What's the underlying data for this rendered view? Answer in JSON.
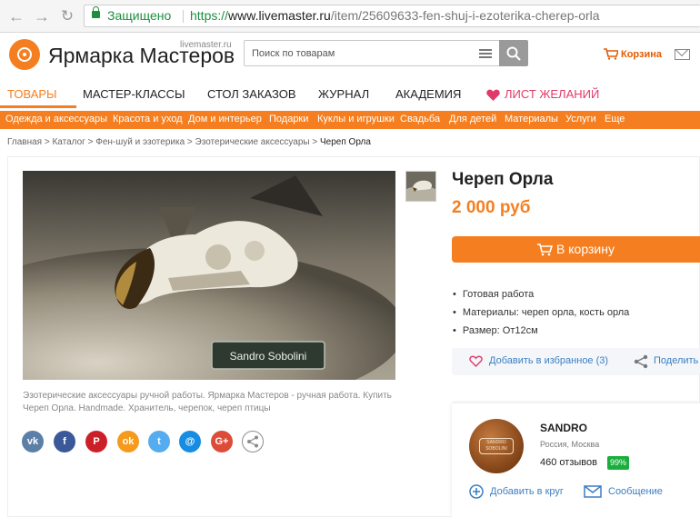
{
  "browser": {
    "secure_label": "Защищено",
    "url_scheme": "https://",
    "url_host": "www.livemaster.ru",
    "url_path": "/item/25609633-fen-shuj-i-ezoterika-cherep-orla"
  },
  "header": {
    "brand": "Ярмарка Мастеров",
    "brand_sub": "livemaster.ru",
    "search_placeholder": "Поиск по товарам",
    "cart_label": "Корзина"
  },
  "main_nav": [
    {
      "label": "ТОВАРЫ"
    },
    {
      "label": "МАСТЕР-КЛАССЫ"
    },
    {
      "label": "СТОЛ ЗАКАЗОВ"
    },
    {
      "label": "ЖУРНАЛ"
    },
    {
      "label": "АКАДЕМИЯ"
    },
    {
      "label": "ЛИСТ ЖЕЛАНИЙ"
    }
  ],
  "categories": [
    {
      "label": "Одежда и аксессуары"
    },
    {
      "label": "Красота и уход"
    },
    {
      "label": "Дом и интерьер"
    },
    {
      "label": "Подарки"
    },
    {
      "label": "Куклы и игрушки"
    },
    {
      "label": "Свадьба"
    },
    {
      "label": "Для детей"
    },
    {
      "label": "Материалы"
    },
    {
      "label": "Услуги"
    },
    {
      "label": "Еще"
    }
  ],
  "breadcrumbs": [
    {
      "label": "Главная"
    },
    {
      "label": "Каталог"
    },
    {
      "label": "Фен-шуй и эзотерика"
    },
    {
      "label": "Эзотерические аксессуары"
    },
    {
      "label": "Череп Орла"
    }
  ],
  "product": {
    "watermark": "Sandro Sobolini",
    "caption": "Эзотерические аксессуары ручной работы. Ярмарка Мастеров - ручная работа. Купить Череп Орла. Handmade. Хранитель, черепок, череп птицы",
    "title": "Череп Орла",
    "price": "2 000 руб",
    "buy_label": "В корзину",
    "properties": [
      {
        "text": "Готовая работа"
      },
      {
        "text": "Материалы:  череп орла, кость орла"
      },
      {
        "text": "Размер: От12см"
      }
    ],
    "favorite_label": "Добавить в избранное (3)",
    "share_label": "Поделить"
  },
  "social": [
    {
      "label": "vk",
      "icon": "vk-icon",
      "color": "#5b7fa6"
    },
    {
      "label": "f",
      "icon": "facebook-icon",
      "color": "#3b5998"
    },
    {
      "label": "P",
      "icon": "pinterest-icon",
      "color": "#cb2027"
    },
    {
      "label": "ok",
      "icon": "odnoklassniki-icon",
      "color": "#f59a1c"
    },
    {
      "label": "t",
      "icon": "twitter-icon",
      "color": "#55acee"
    },
    {
      "label": "@",
      "icon": "mail-ru-icon",
      "color": "#168de2"
    },
    {
      "label": "G+",
      "icon": "google-plus-icon",
      "color": "#dd4b39"
    },
    {
      "label": "",
      "icon": "share-icon",
      "color": "#8c8c8c"
    }
  ],
  "seller": {
    "name": "SANDRO",
    "location": "Россия, Москва",
    "reviews": "460 отзывов",
    "rating": "99%",
    "add_circle_label": "Добавить в круг",
    "message_label": "Сообщение",
    "avatar_text": "SANDRO SOBOLINI"
  },
  "colors": {
    "accent": "#f57f20",
    "link": "#3d7fc2",
    "wish": "#e2396a",
    "secure": "#1e8e3e"
  }
}
